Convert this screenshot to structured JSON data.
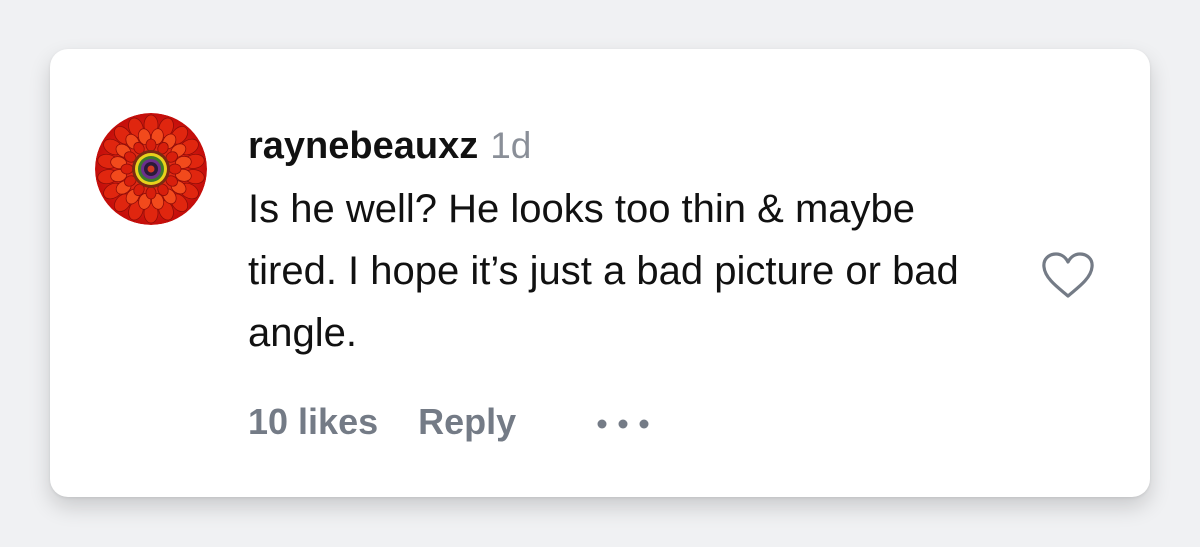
{
  "comment": {
    "username": "raynebeauxz",
    "time_ago": "1d",
    "text": "Is he well? He looks too thin & maybe tired. I hope it’s just a bad picture or bad angle.",
    "likes": "10 likes",
    "reply_label": "Reply"
  },
  "icons": {
    "like": "heart-outline-icon",
    "more": "ellipsis-icon"
  },
  "colors": {
    "background": "#f0f1f3",
    "card": "#ffffff",
    "text_primary": "#111111",
    "text_secondary": "#747b86",
    "icon": "#747b86"
  }
}
